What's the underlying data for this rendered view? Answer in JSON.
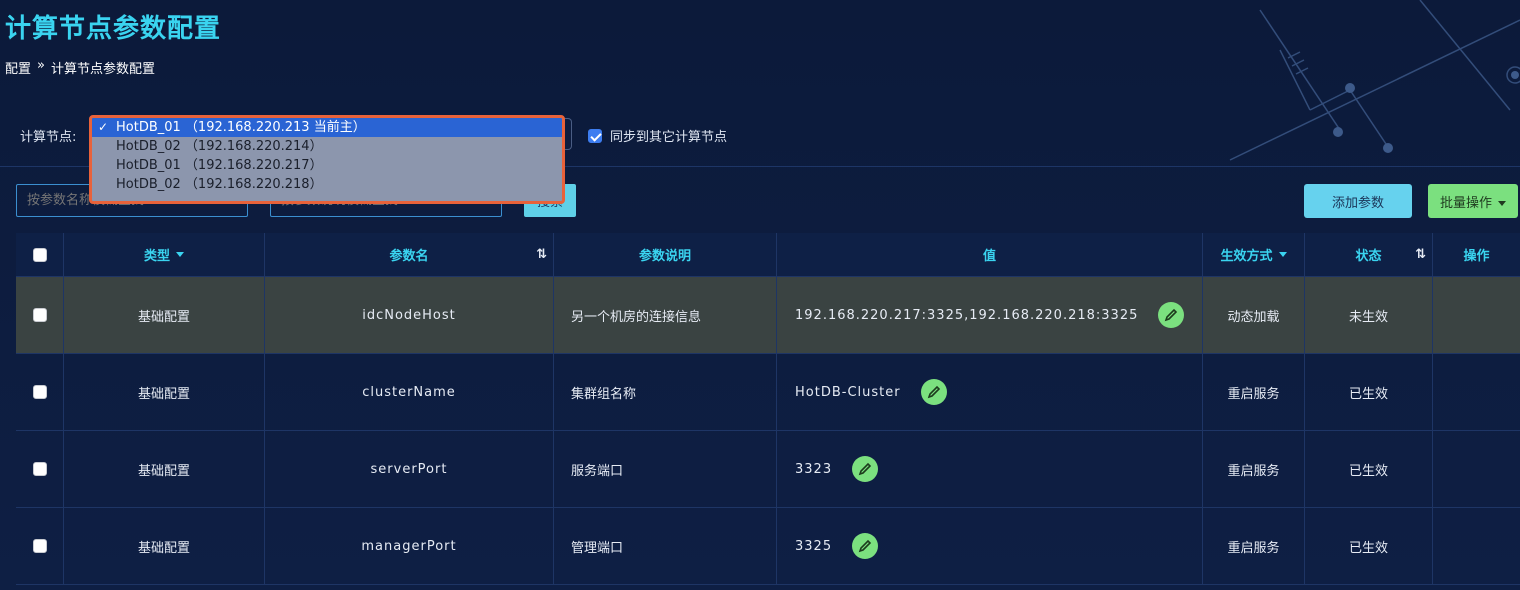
{
  "page": {
    "title": "计算节点参数配置"
  },
  "breadcrumb": {
    "root": "配置",
    "separator": "»",
    "current": "计算节点参数配置"
  },
  "node_selector": {
    "label": "计算节点:",
    "options": [
      {
        "text": "HotDB_01 （192.168.220.213 当前主）",
        "selected": true
      },
      {
        "text": "HotDB_02 （192.168.220.214）",
        "selected": false
      },
      {
        "text": "HotDB_01 （192.168.220.217）",
        "selected": false
      },
      {
        "text": "HotDB_02 （192.168.220.218）",
        "selected": false
      }
    ]
  },
  "sync": {
    "label": "同步到其它计算节点",
    "checked": true
  },
  "search": {
    "name_placeholder": "按参数名称模糊查找",
    "desc_placeholder": "按参数说明模糊查找",
    "button": "搜索"
  },
  "actions": {
    "add": "添加参数",
    "batch": "批量操作"
  },
  "table": {
    "headers": {
      "type": "类型",
      "name": "参数名",
      "desc": "参数说明",
      "value": "值",
      "mode": "生效方式",
      "status": "状态",
      "ops": "操作"
    },
    "rows": [
      {
        "type": "基础配置",
        "name": "idcNodeHost",
        "desc": "另一个机房的连接信息",
        "value": "192.168.220.217:3325,192.168.220.218:3325",
        "mode": "动态加载",
        "status": "未生效"
      },
      {
        "type": "基础配置",
        "name": "clusterName",
        "desc": "集群组名称",
        "value": "HotDB-Cluster",
        "mode": "重启服务",
        "status": "已生效"
      },
      {
        "type": "基础配置",
        "name": "serverPort",
        "desc": "服务端口",
        "value": "3323",
        "mode": "重启服务",
        "status": "已生效"
      },
      {
        "type": "基础配置",
        "name": "managerPort",
        "desc": "管理端口",
        "value": "3325",
        "mode": "重启服务",
        "status": "已生效"
      }
    ]
  },
  "colors": {
    "accent": "#3ad4f0",
    "background": "#0d1c3e",
    "edit_button": "#7be07f",
    "dropdown_border": "#e8623a"
  }
}
